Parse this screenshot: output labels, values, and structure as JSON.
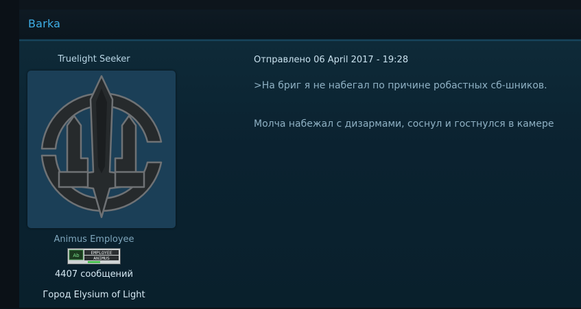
{
  "post": {
    "title": "Barka",
    "meta": "Отправлено 06 April 2017 - 19:28",
    "lines": [
      ">На бриг я не набегал по причине робастных сб-шников.",
      "Молча набежал с дизармами, соснул и гостнулся в камере"
    ]
  },
  "author": {
    "name": "Truelight Seeker",
    "avatar_icon": "trident-emblem-icon",
    "rank": "Animus Employee",
    "badge": {
      "line1": "EMPLOYEE",
      "line2": "ANIMUS",
      "icon": "abstergo-logo-icon"
    },
    "posts_count": "4407 сообщений",
    "location": "Город Elysium of Light"
  },
  "colors": {
    "title": "#3eaee6",
    "post_bg": "#0b2230",
    "avatar_bg": "#1b3f57",
    "text": "#8fb1c4"
  }
}
